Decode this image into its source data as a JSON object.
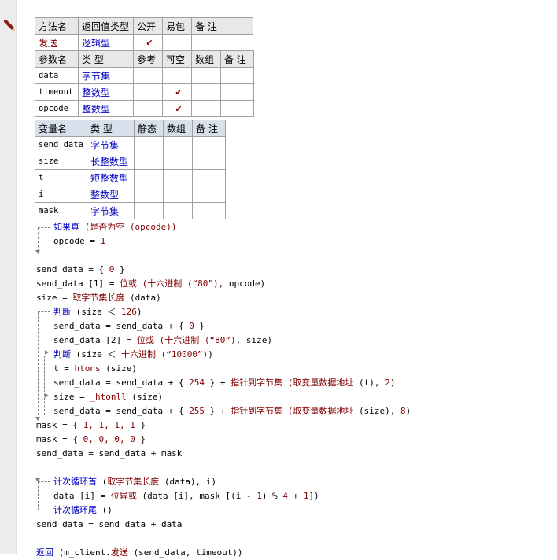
{
  "method_table": {
    "headers": [
      "方法名",
      "返回值类型",
      "公开",
      "易包",
      "备 注"
    ],
    "row": {
      "name": "发送",
      "return_type": "逻辑型",
      "public_mark": "✔"
    }
  },
  "param_table": {
    "headers": [
      "参数名",
      "类 型",
      "参考",
      "可空",
      "数组",
      "备 注"
    ],
    "rows": [
      {
        "name": "data",
        "type": "字节集",
        "optional_mark": ""
      },
      {
        "name": "timeout",
        "type": "整数型",
        "optional_mark": "✔"
      },
      {
        "name": "opcode",
        "type": "整数型",
        "optional_mark": "✔"
      }
    ]
  },
  "var_table": {
    "headers": [
      "变量名",
      "类 型",
      "静态",
      "数组",
      "备 注"
    ],
    "rows": [
      {
        "name": "send_data",
        "type": "字节集"
      },
      {
        "name": "size",
        "type": "长整数型"
      },
      {
        "name": "t",
        "type": "短整数型"
      },
      {
        "name": "i",
        "type": "整数型"
      },
      {
        "name": "mask",
        "type": "字节集"
      }
    ]
  },
  "code_lines": [
    {
      "indent": 1,
      "parts": [
        {
          "t": "如果真",
          "c": "kw"
        },
        {
          "t": " (是否为空 (opcode))",
          "c": "fn"
        }
      ]
    },
    {
      "indent": 1,
      "parts": [
        {
          "t": "opcode = ",
          "c": ""
        },
        {
          "t": "1",
          "c": "nm"
        }
      ]
    },
    {
      "indent": 0,
      "parts": []
    },
    {
      "indent": 0,
      "parts": [
        {
          "t": "send_data = { ",
          "c": ""
        },
        {
          "t": "0",
          "c": "nm"
        },
        {
          "t": " }",
          "c": ""
        }
      ]
    },
    {
      "indent": 0,
      "parts": [
        {
          "t": "send_data [1] = ",
          "c": ""
        },
        {
          "t": "位或 (十六进制 (“80”)",
          "c": "fn"
        },
        {
          "t": ", opcode)",
          "c": ""
        }
      ]
    },
    {
      "indent": 0,
      "parts": [
        {
          "t": "size = ",
          "c": ""
        },
        {
          "t": "取字节集长度",
          "c": "fn"
        },
        {
          "t": " (data)",
          "c": ""
        }
      ]
    },
    {
      "indent": 1,
      "parts": [
        {
          "t": "判断",
          "c": "kw"
        },
        {
          "t": " (size ＜ ",
          "c": ""
        },
        {
          "t": "126",
          "c": "nm"
        },
        {
          "t": ")",
          "c": ""
        }
      ]
    },
    {
      "indent": 1,
      "parts": [
        {
          "t": "send_data = send_data + { ",
          "c": ""
        },
        {
          "t": "0",
          "c": "nm"
        },
        {
          "t": " }",
          "c": ""
        }
      ]
    },
    {
      "indent": 1,
      "parts": [
        {
          "t": "send_data [2] = ",
          "c": ""
        },
        {
          "t": "位或 (十六进制 (“80”)",
          "c": "fn"
        },
        {
          "t": ", size)",
          "c": ""
        }
      ]
    },
    {
      "indent": 1,
      "parts": [
        {
          "t": "判断",
          "c": "kw"
        },
        {
          "t": " (size ＜ ",
          "c": ""
        },
        {
          "t": "十六进制 (“10000”)",
          "c": "fn"
        },
        {
          "t": ")",
          "c": ""
        }
      ]
    },
    {
      "indent": 1,
      "parts": [
        {
          "t": "t = ",
          "c": ""
        },
        {
          "t": "htons",
          "c": "fn"
        },
        {
          "t": " (size)",
          "c": ""
        }
      ]
    },
    {
      "indent": 1,
      "parts": [
        {
          "t": "send_data = send_data + { ",
          "c": ""
        },
        {
          "t": "254",
          "c": "nm"
        },
        {
          "t": " } + ",
          "c": ""
        },
        {
          "t": "指针到字节集 (取变量数据地址",
          "c": "fn"
        },
        {
          "t": " (t), ",
          "c": ""
        },
        {
          "t": "2",
          "c": "nm"
        },
        {
          "t": ")",
          "c": ""
        }
      ]
    },
    {
      "indent": 1,
      "parts": [
        {
          "t": "size = ",
          "c": ""
        },
        {
          "t": "_htonll",
          "c": "fn"
        },
        {
          "t": " (size)",
          "c": ""
        }
      ]
    },
    {
      "indent": 1,
      "parts": [
        {
          "t": "send_data = send_data + { ",
          "c": ""
        },
        {
          "t": "255",
          "c": "nm"
        },
        {
          "t": " } + ",
          "c": ""
        },
        {
          "t": "指针到字节集 (取变量数据地址",
          "c": "fn"
        },
        {
          "t": " (size), ",
          "c": ""
        },
        {
          "t": "8",
          "c": "nm"
        },
        {
          "t": ")",
          "c": ""
        }
      ]
    },
    {
      "indent": 0,
      "parts": [
        {
          "t": "mask = { ",
          "c": ""
        },
        {
          "t": "1, 1, 1, 1",
          "c": "nm"
        },
        {
          "t": " }",
          "c": ""
        }
      ]
    },
    {
      "indent": 0,
      "parts": [
        {
          "t": "mask = { ",
          "c": ""
        },
        {
          "t": "0, 0, 0, 0",
          "c": "nm"
        },
        {
          "t": " }",
          "c": ""
        }
      ]
    },
    {
      "indent": 0,
      "parts": [
        {
          "t": "send_data = send_data + mask",
          "c": ""
        }
      ]
    },
    {
      "indent": 0,
      "parts": []
    },
    {
      "indent": 1,
      "parts": [
        {
          "t": "计次循环首",
          "c": "kw"
        },
        {
          "t": " (",
          "c": ""
        },
        {
          "t": "取字节集长度",
          "c": "fn"
        },
        {
          "t": " (data), i)",
          "c": ""
        }
      ]
    },
    {
      "indent": 1,
      "parts": [
        {
          "t": "data [i] = ",
          "c": ""
        },
        {
          "t": "位异或",
          "c": "fn"
        },
        {
          "t": " (data [i], mask [(i - ",
          "c": ""
        },
        {
          "t": "1",
          "c": "nm"
        },
        {
          "t": ") % ",
          "c": ""
        },
        {
          "t": "4",
          "c": "nm"
        },
        {
          "t": " + ",
          "c": ""
        },
        {
          "t": "1",
          "c": "nm"
        },
        {
          "t": "])",
          "c": ""
        }
      ]
    },
    {
      "indent": 1,
      "parts": [
        {
          "t": "计次循环尾",
          "c": "kw"
        },
        {
          "t": " ()",
          "c": ""
        }
      ]
    },
    {
      "indent": 0,
      "parts": [
        {
          "t": "send_data = send_data + data",
          "c": ""
        }
      ]
    },
    {
      "indent": 0,
      "parts": []
    },
    {
      "indent": 0,
      "parts": [
        {
          "t": "返回",
          "c": "kw"
        },
        {
          "t": " (m_client.",
          "c": ""
        },
        {
          "t": "发送",
          "c": "fn"
        },
        {
          "t": " (send_data, timeout))",
          "c": ""
        }
      ]
    }
  ]
}
